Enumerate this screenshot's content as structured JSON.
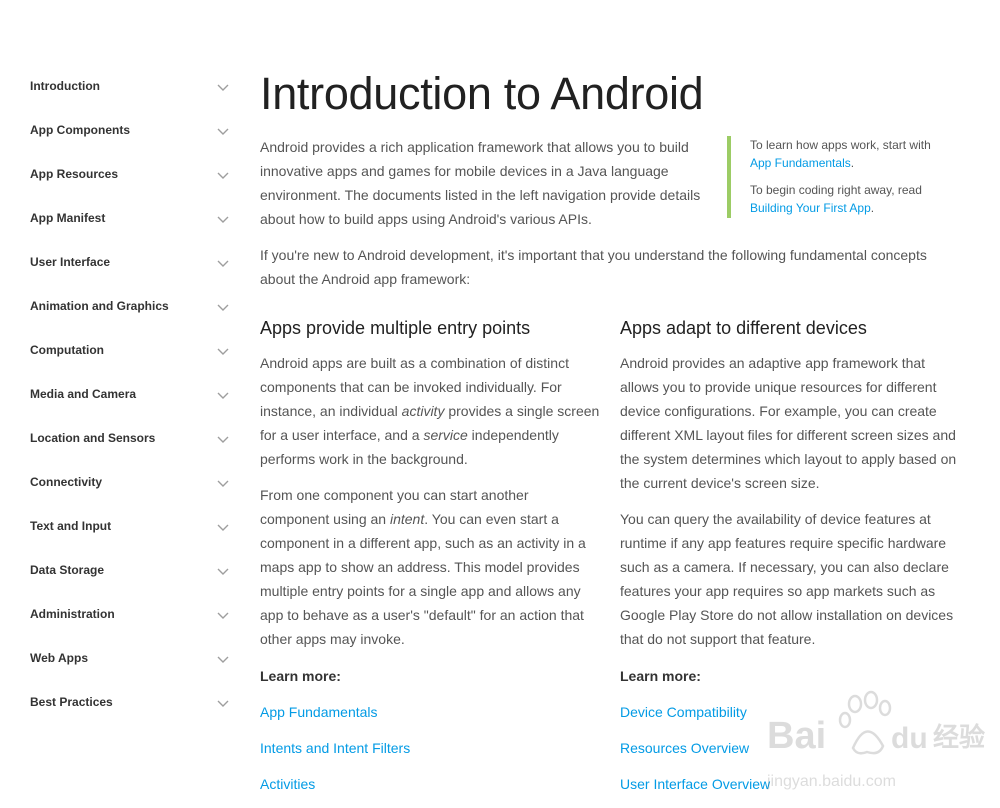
{
  "sidebar": {
    "items": [
      {
        "label": "Introduction"
      },
      {
        "label": "App Components"
      },
      {
        "label": "App Resources"
      },
      {
        "label": "App Manifest"
      },
      {
        "label": "User Interface"
      },
      {
        "label": "Animation and Graphics"
      },
      {
        "label": "Computation"
      },
      {
        "label": "Media and Camera"
      },
      {
        "label": "Location and Sensors"
      },
      {
        "label": "Connectivity"
      },
      {
        "label": "Text and Input"
      },
      {
        "label": "Data Storage"
      },
      {
        "label": "Administration"
      },
      {
        "label": "Web Apps"
      },
      {
        "label": "Best Practices"
      }
    ]
  },
  "page": {
    "title": "Introduction to Android",
    "intro": "Android provides a rich application framework that allows you to build innovative apps and games for mobile devices in a Java language environment. The documents listed in the left navigation provide details about how to build apps using Android's various APIs.",
    "intro2": "If you're new to Android development, it's important that you understand the following fundamental concepts about the Android app framework:"
  },
  "callout": {
    "line1_text": "To learn how apps work, start with",
    "line1_link": "App Fundamentals",
    "line2_text": "To begin coding right away, read",
    "line2_link": "Building Your First App"
  },
  "left_col": {
    "heading": "Apps provide multiple entry points",
    "p1_a": "Android apps are built as a combination of distinct components that can be invoked individually. For instance, an individual ",
    "p1_em1": "activity",
    "p1_b": " provides a single screen for a user interface, and a ",
    "p1_em2": "service",
    "p1_c": " independently performs work in the background.",
    "p2_a": "From one component you can start another component using an ",
    "p2_em": "intent",
    "p2_b": ". You can even start a component in a different app, such as an activity in a maps app to show an address. This model provides multiple entry points for a single app and allows any app to behave as a user's \"default\" for an action that other apps may invoke.",
    "learn_more": "Learn more:",
    "links": [
      "App Fundamentals",
      "Intents and Intent Filters",
      "Activities"
    ]
  },
  "right_col": {
    "heading": "Apps adapt to different devices",
    "p1": "Android provides an adaptive app framework that allows you to provide unique resources for different device configurations. For example, you can create different XML layout files for different screen sizes and the system determines which layout to apply based on the current device's screen size.",
    "p2": "You can query the availability of device features at runtime if any app features require specific hardware such as a camera. If necessary, you can also declare features your app requires so app markets such as Google Play Store do not allow installation on devices that do not support that feature.",
    "learn_more": "Learn more:",
    "links": [
      "Device Compatibility",
      "Resources Overview",
      "User Interface Overview"
    ]
  },
  "watermark": {
    "brand": "Bai",
    "brand2": "du",
    "cn": "经验",
    "url": "jingyan.baidu.com"
  },
  "colors": {
    "link": "#039be5",
    "callout_border": "#9ccc65",
    "heading": "#212121",
    "body": "#555555"
  }
}
